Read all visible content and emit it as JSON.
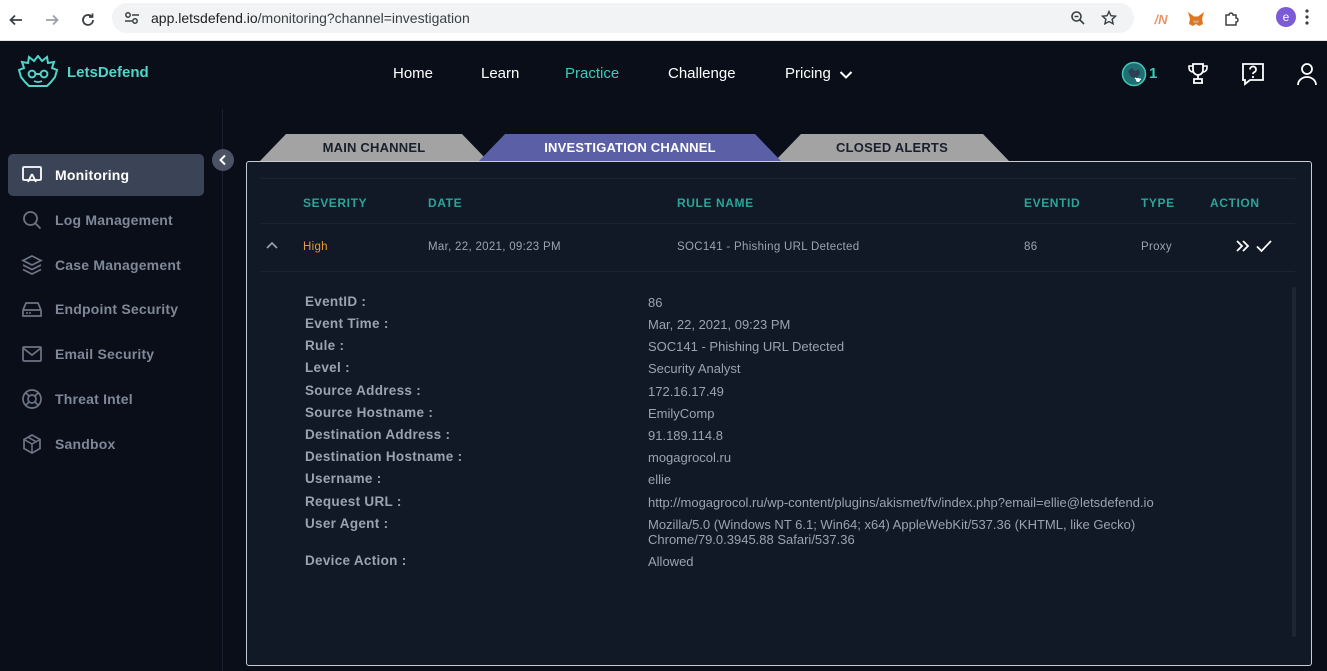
{
  "browser": {
    "url_host": "app.letsdefend.io",
    "url_path": "/monitoring?channel=investigation",
    "profile_initial": "e"
  },
  "app": {
    "brand": "LetsDefend",
    "nav": [
      {
        "label": "Home"
      },
      {
        "label": "Learn"
      },
      {
        "label": "Practice"
      },
      {
        "label": "Challenge"
      },
      {
        "label": "Pricing"
      }
    ],
    "notification_count": "1"
  },
  "sidebar": {
    "items": [
      {
        "label": "Monitoring",
        "icon": "monitor-icon"
      },
      {
        "label": "Log Management",
        "icon": "search-icon"
      },
      {
        "label": "Case Management",
        "icon": "layers-icon"
      },
      {
        "label": "Endpoint Security",
        "icon": "hard-drive-icon"
      },
      {
        "label": "Email Security",
        "icon": "mail-icon"
      },
      {
        "label": "Threat Intel",
        "icon": "life-buoy-icon"
      },
      {
        "label": "Sandbox",
        "icon": "cube-icon"
      }
    ]
  },
  "tabs": [
    {
      "label": "MAIN CHANNEL"
    },
    {
      "label": "INVESTIGATION CHANNEL"
    },
    {
      "label": "CLOSED ALERTS"
    }
  ],
  "table": {
    "headers": [
      "SEVERITY",
      "DATE",
      "RULE NAME",
      "EVENTID",
      "TYPE",
      "ACTION"
    ],
    "row": {
      "severity": "High",
      "date": "Mar, 22, 2021, 09:23 PM",
      "rule_name": "SOC141 - Phishing URL Detected",
      "eventid": "86",
      "type": "Proxy"
    }
  },
  "details": [
    {
      "label": "EventID :",
      "value": "86"
    },
    {
      "label": "Event Time :",
      "value": "Mar, 22, 2021, 09:23 PM"
    },
    {
      "label": "Rule :",
      "value": "SOC141 - Phishing URL Detected"
    },
    {
      "label": "Level :",
      "value": "Security Analyst"
    },
    {
      "label": "Source Address :",
      "value": "172.16.17.49"
    },
    {
      "label": "Source Hostname :",
      "value": "EmilyComp"
    },
    {
      "label": "Destination Address :",
      "value": "91.189.114.8"
    },
    {
      "label": "Destination Hostname :",
      "value": "mogagrocol.ru"
    },
    {
      "label": "Username :",
      "value": "ellie"
    },
    {
      "label": "Request URL :",
      "value": "http://mogagrocol.ru/wp-content/plugins/akismet/fv/index.php?email=ellie@letsdefend.io"
    },
    {
      "label": "User Agent :",
      "value": "Mozilla/5.0 (Windows NT 6.1; Win64; x64) AppleWebKit/537.36 (KHTML, like Gecko) Chrome/79.0.3945.88 Safari/537.36"
    },
    {
      "label": "Device Action :",
      "value": "Allowed"
    }
  ],
  "colors": {
    "accent": "#3ec9bb",
    "severity_high": "#e59a3a",
    "active_tab": "#5b5fa6",
    "inactive_tab": "#a3a3a3"
  }
}
